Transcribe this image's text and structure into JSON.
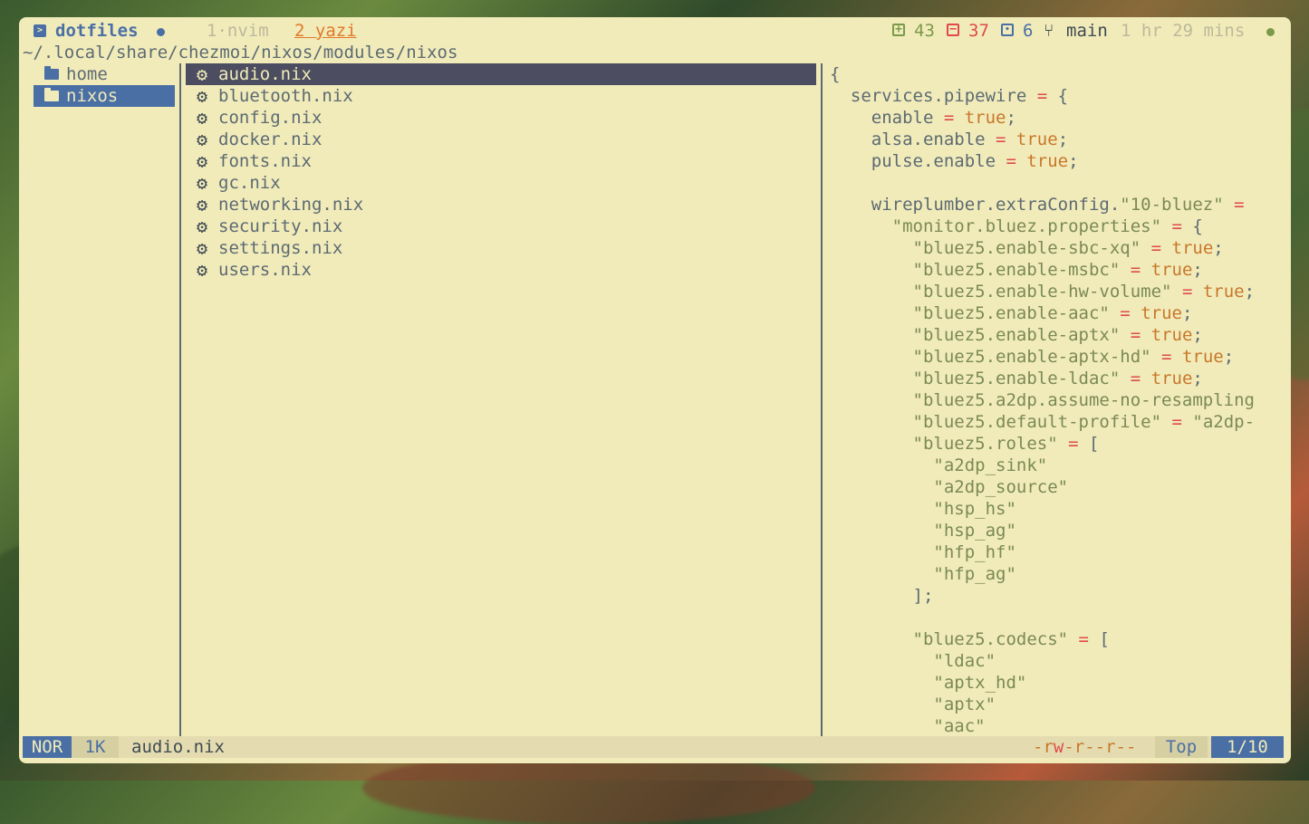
{
  "tabbar": {
    "session_name": "dotfiles",
    "tab1": "1·nvim",
    "tab2": "2 yazi",
    "added": "43",
    "removed": "37",
    "changed": "6",
    "branch": "main",
    "elapsed": "1 hr 29 mins"
  },
  "path": "~/.local/share/chezmoi/nixos/modules/nixos",
  "parent": [
    {
      "label": "home"
    },
    {
      "label": "nixos",
      "selected": true
    }
  ],
  "files": [
    {
      "label": "audio.nix",
      "selected": true
    },
    {
      "label": "bluetooth.nix"
    },
    {
      "label": "config.nix"
    },
    {
      "label": "docker.nix"
    },
    {
      "label": "fonts.nix"
    },
    {
      "label": "gc.nix"
    },
    {
      "label": "networking.nix"
    },
    {
      "label": "security.nix"
    },
    {
      "label": "settings.nix"
    },
    {
      "label": "users.nix"
    }
  ],
  "preview_lines": [
    [
      [
        "p",
        "{"
      ]
    ],
    [
      [
        "k",
        "  services.pipewire "
      ],
      [
        "o",
        "="
      ],
      [
        "p",
        " {"
      ]
    ],
    [
      [
        "k",
        "    enable "
      ],
      [
        "o",
        "="
      ],
      [
        "b",
        " true"
      ],
      [
        "p",
        ";"
      ]
    ],
    [
      [
        "k",
        "    alsa.enable "
      ],
      [
        "o",
        "="
      ],
      [
        "b",
        " true"
      ],
      [
        "p",
        ";"
      ]
    ],
    [
      [
        "k",
        "    pulse.enable "
      ],
      [
        "o",
        "="
      ],
      [
        "b",
        " true"
      ],
      [
        "p",
        ";"
      ]
    ],
    [
      [
        "p",
        ""
      ]
    ],
    [
      [
        "k",
        "    wireplumber.extraConfig."
      ],
      [
        "s",
        "\"10-bluez\""
      ],
      [
        "o",
        " ="
      ]
    ],
    [
      [
        "s",
        "      \"monitor.bluez.properties\""
      ],
      [
        "o",
        " ="
      ],
      [
        "p",
        " {"
      ]
    ],
    [
      [
        "s",
        "        \"bluez5.enable-sbc-xq\""
      ],
      [
        "o",
        " ="
      ],
      [
        "b",
        " true"
      ],
      [
        "p",
        ";"
      ]
    ],
    [
      [
        "s",
        "        \"bluez5.enable-msbc\""
      ],
      [
        "o",
        " ="
      ],
      [
        "b",
        " true"
      ],
      [
        "p",
        ";"
      ]
    ],
    [
      [
        "s",
        "        \"bluez5.enable-hw-volume\""
      ],
      [
        "o",
        " ="
      ],
      [
        "b",
        " true"
      ],
      [
        "p",
        ";"
      ]
    ],
    [
      [
        "s",
        "        \"bluez5.enable-aac\""
      ],
      [
        "o",
        " ="
      ],
      [
        "b",
        " true"
      ],
      [
        "p",
        ";"
      ]
    ],
    [
      [
        "s",
        "        \"bluez5.enable-aptx\""
      ],
      [
        "o",
        " ="
      ],
      [
        "b",
        " true"
      ],
      [
        "p",
        ";"
      ]
    ],
    [
      [
        "s",
        "        \"bluez5.enable-aptx-hd\""
      ],
      [
        "o",
        " ="
      ],
      [
        "b",
        " true"
      ],
      [
        "p",
        ";"
      ]
    ],
    [
      [
        "s",
        "        \"bluez5.enable-ldac\""
      ],
      [
        "o",
        " ="
      ],
      [
        "b",
        " true"
      ],
      [
        "p",
        ";"
      ]
    ],
    [
      [
        "s",
        "        \"bluez5.a2dp.assume-no-resampling"
      ]
    ],
    [
      [
        "s",
        "        \"bluez5.default-profile\""
      ],
      [
        "o",
        " ="
      ],
      [
        "s",
        " \"a2dp-"
      ]
    ],
    [
      [
        "s",
        "        \"bluez5.roles\""
      ],
      [
        "o",
        " ="
      ],
      [
        "p",
        " ["
      ]
    ],
    [
      [
        "s",
        "          \"a2dp_sink\""
      ]
    ],
    [
      [
        "s",
        "          \"a2dp_source\""
      ]
    ],
    [
      [
        "s",
        "          \"hsp_hs\""
      ]
    ],
    [
      [
        "s",
        "          \"hsp_ag\""
      ]
    ],
    [
      [
        "s",
        "          \"hfp_hf\""
      ]
    ],
    [
      [
        "s",
        "          \"hfp_ag\""
      ]
    ],
    [
      [
        "p",
        "        ];"
      ]
    ],
    [
      [
        "p",
        ""
      ]
    ],
    [
      [
        "s",
        "        \"bluez5.codecs\""
      ],
      [
        "o",
        " ="
      ],
      [
        "p",
        " ["
      ]
    ],
    [
      [
        "s",
        "          \"ldac\""
      ]
    ],
    [
      [
        "s",
        "          \"aptx_hd\""
      ]
    ],
    [
      [
        "s",
        "          \"aptx\""
      ]
    ],
    [
      [
        "s",
        "          \"aac\""
      ]
    ]
  ],
  "status": {
    "mode": "NOR",
    "size": "1K",
    "filename": "audio.nix",
    "perms_prefix": "-r",
    "perms_w": "w",
    "perms_suffix": "-r--r--",
    "position": "Top",
    "count": "1/10"
  },
  "colors": {
    "background": "#f1ebba",
    "accent_blue": "#4a6fa5",
    "selection_dark": "#4c4d60",
    "added_green": "#7a9a4a",
    "removed_red": "#e04a4a",
    "keyword_orange": "#c8772a",
    "string_green": "#7b8a52"
  }
}
